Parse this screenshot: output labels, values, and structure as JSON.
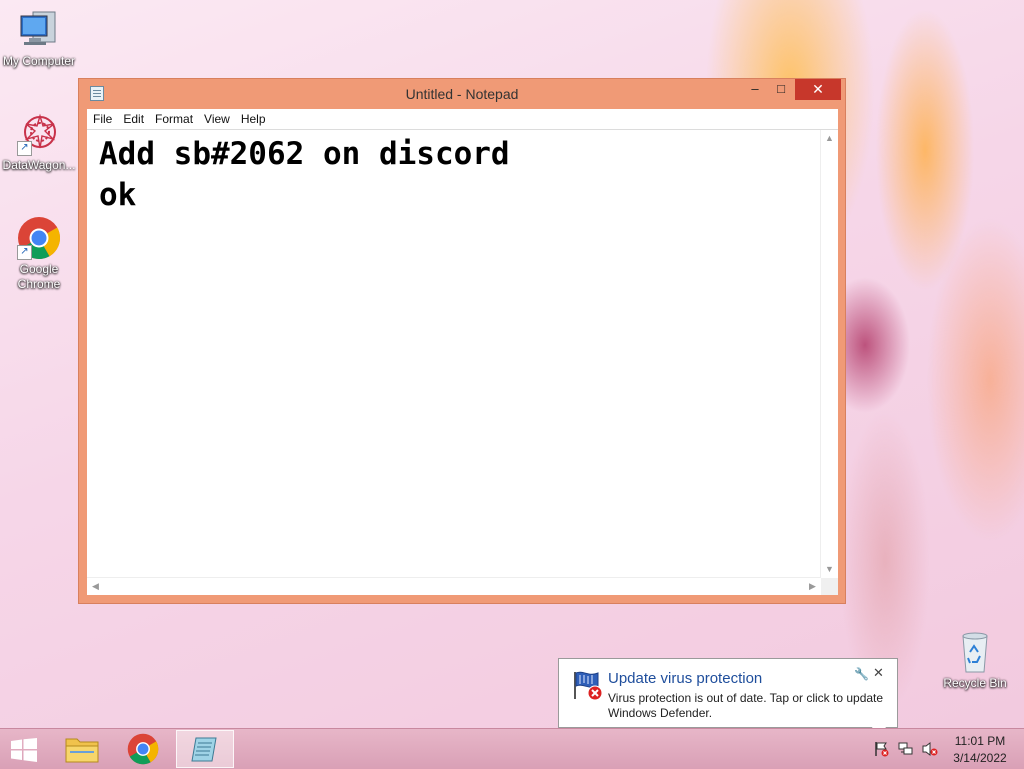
{
  "desktop": {
    "icons": [
      {
        "label": "My Computer"
      },
      {
        "label": "DataWagon..."
      },
      {
        "label": "Google Chrome"
      },
      {
        "label": "Recycle Bin"
      }
    ]
  },
  "notepad": {
    "title": "Untitled - Notepad",
    "controls": {
      "minimize": "–",
      "maximize": "□",
      "close": "✕"
    },
    "menu": [
      "File",
      "Edit",
      "Format",
      "View",
      "Help"
    ],
    "content": "Add sb#2062 on discord\nok"
  },
  "notification": {
    "title": "Update virus protection",
    "body": "Virus protection is out of date. Tap or click to update Windows Defender.",
    "close": "✕"
  },
  "taskbar": {
    "clock_time": "11:01 PM",
    "clock_date": "3/14/2022"
  },
  "colors": {
    "window_frame": "#f09a76",
    "close_button": "#c7372b",
    "taskbar": "#d9a0b6",
    "notification_title": "#1f4e9c"
  }
}
